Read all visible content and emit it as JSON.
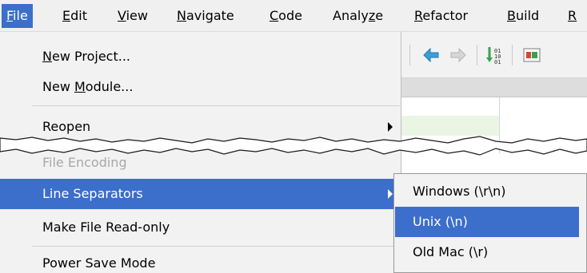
{
  "menubar": {
    "items": [
      {
        "pre": "",
        "u": "F",
        "post": "ile"
      },
      {
        "pre": "",
        "u": "E",
        "post": "dit"
      },
      {
        "pre": "",
        "u": "V",
        "post": "iew"
      },
      {
        "pre": "",
        "u": "N",
        "post": "avigate"
      },
      {
        "pre": "",
        "u": "C",
        "post": "ode"
      },
      {
        "pre": "Analy",
        "u": "z",
        "post": "e"
      },
      {
        "pre": "",
        "u": "R",
        "post": "efactor"
      },
      {
        "pre": "",
        "u": "B",
        "post": "uild"
      },
      {
        "pre": "",
        "u": "R",
        "post": ""
      }
    ],
    "active_index": 0
  },
  "file_menu": {
    "new_project": {
      "pre": "",
      "u": "N",
      "post": "ew Project..."
    },
    "new_module": {
      "pre": "New ",
      "u": "M",
      "post": "odule..."
    },
    "reopen": "Reopen",
    "file_encoding": "File Encoding",
    "line_separators": "Line Separators",
    "make_read_only": "Make File Read-only",
    "power_save": "Power Save Mode"
  },
  "line_separators_submenu": {
    "items": [
      "Windows (\\r\\n)",
      "Unix (\\n)",
      "Old Mac (\\r)"
    ],
    "selected_index": 1
  },
  "toolbar": {
    "icons": [
      "back-arrow-icon",
      "forward-arrow-icon",
      "sort-binary-icon",
      "run-config-icon"
    ]
  },
  "colors": {
    "selection": "#3c6ecb",
    "menu_bg": "#f2f2f2"
  }
}
